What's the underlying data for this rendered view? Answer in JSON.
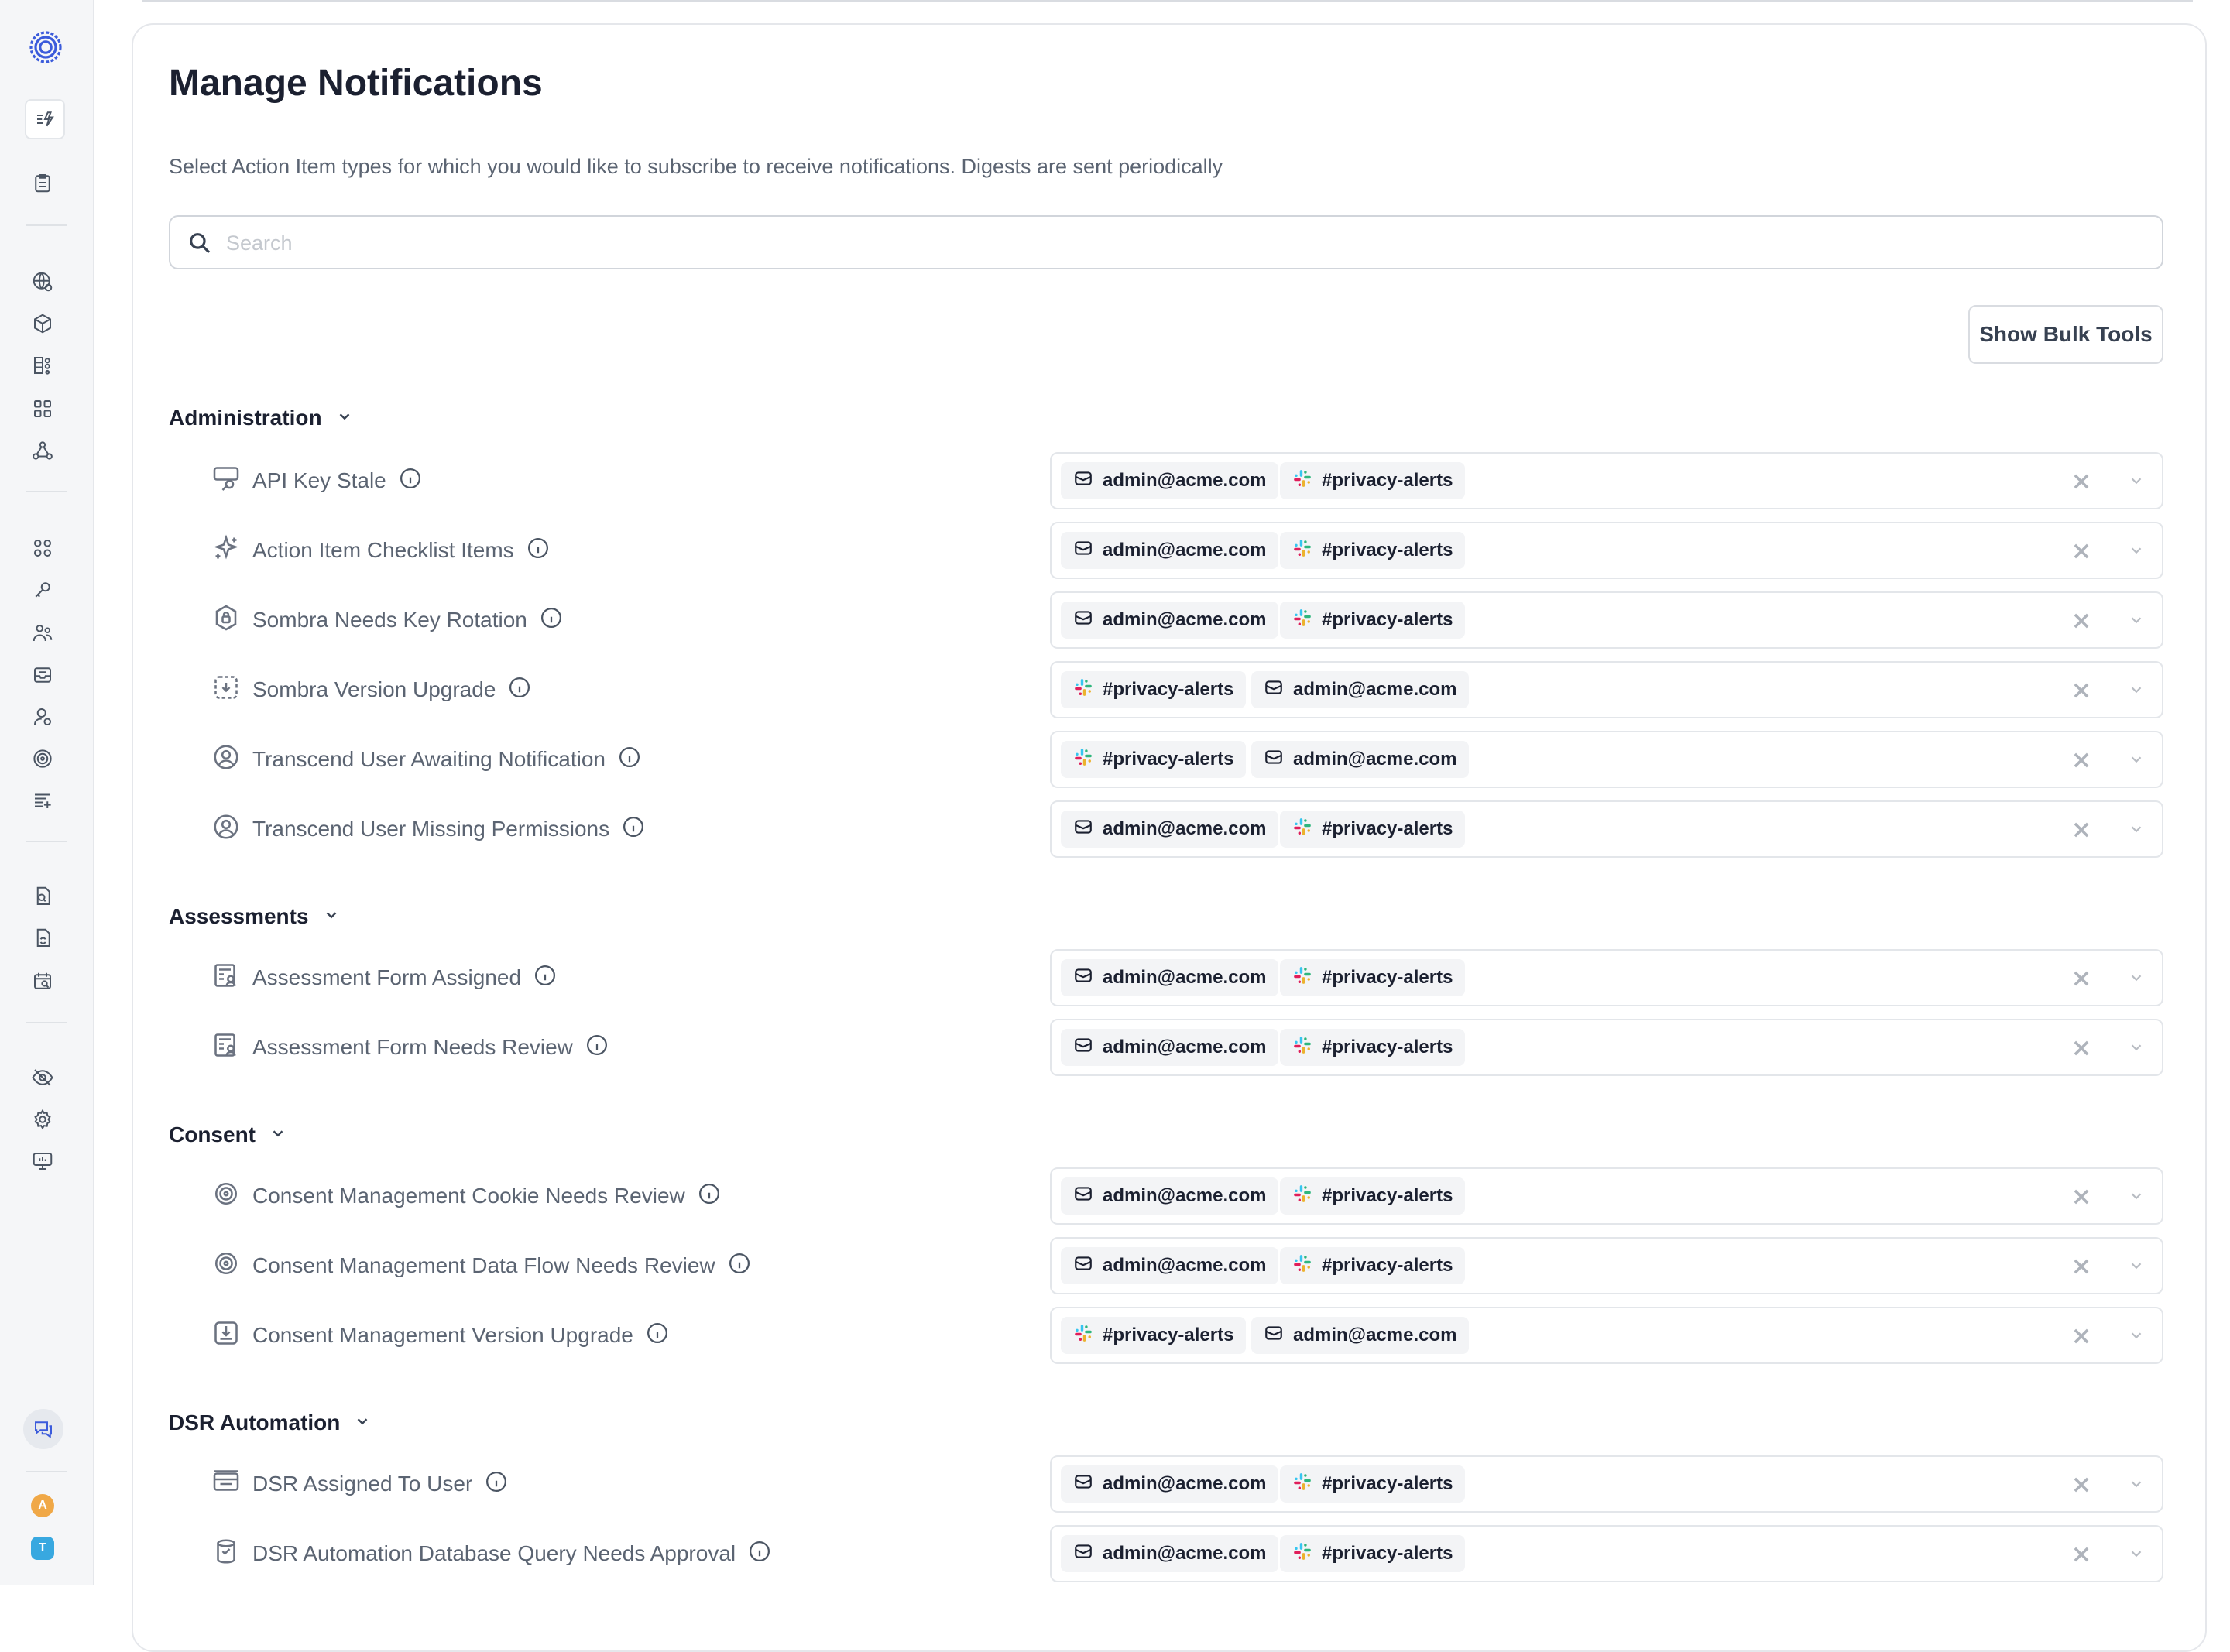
{
  "page": {
    "title": "Manage Notifications",
    "subtitle": "Select Action Item types for which you would like to subscribe to receive notifications. Digests are sent periodically"
  },
  "search": {
    "placeholder": "Search",
    "value": ""
  },
  "bulk_button": "Show Bulk Tools",
  "avatars": [
    {
      "letter": "A",
      "color": "#f0a847"
    },
    {
      "letter": "T",
      "color": "#38a8e0"
    }
  ],
  "colors": {
    "accent": "#3b5bdb",
    "slack": [
      "#e01e5a",
      "#36c5f0",
      "#2eb67d",
      "#ecb22e"
    ]
  },
  "groups": [
    {
      "title": "Administration",
      "rows": [
        {
          "label": "API Key Stale",
          "icon": "api-key-icon",
          "chips": [
            {
              "type": "email",
              "text": "admin@acme.com"
            },
            {
              "type": "slack",
              "text": "#privacy-alerts"
            }
          ]
        },
        {
          "label": "Action Item Checklist Items",
          "icon": "sparkle-icon",
          "chips": [
            {
              "type": "email",
              "text": "admin@acme.com"
            },
            {
              "type": "slack",
              "text": "#privacy-alerts"
            }
          ]
        },
        {
          "label": "Sombra Needs Key Rotation",
          "icon": "lock-icon",
          "chips": [
            {
              "type": "email",
              "text": "admin@acme.com"
            },
            {
              "type": "slack",
              "text": "#privacy-alerts"
            }
          ]
        },
        {
          "label": "Sombra Version Upgrade",
          "icon": "download-icon",
          "chips": [
            {
              "type": "slack",
              "text": "#privacy-alerts"
            },
            {
              "type": "email",
              "text": "admin@acme.com"
            }
          ]
        },
        {
          "label": "Transcend User Awaiting Notification",
          "icon": "user-circle-icon",
          "chips": [
            {
              "type": "slack",
              "text": "#privacy-alerts"
            },
            {
              "type": "email",
              "text": "admin@acme.com"
            }
          ]
        },
        {
          "label": "Transcend User Missing Permissions",
          "icon": "user-circle-icon",
          "chips": [
            {
              "type": "email",
              "text": "admin@acme.com"
            },
            {
              "type": "slack",
              "text": "#privacy-alerts"
            }
          ]
        }
      ]
    },
    {
      "title": "Assessments",
      "rows": [
        {
          "label": "Assessment Form Assigned",
          "icon": "form-icon",
          "chips": [
            {
              "type": "email",
              "text": "admin@acme.com"
            },
            {
              "type": "slack",
              "text": "#privacy-alerts"
            }
          ]
        },
        {
          "label": "Assessment Form Needs Review",
          "icon": "form-icon",
          "chips": [
            {
              "type": "email",
              "text": "admin@acme.com"
            },
            {
              "type": "slack",
              "text": "#privacy-alerts"
            }
          ]
        }
      ]
    },
    {
      "title": "Consent",
      "rows": [
        {
          "label": "Consent Management Cookie Needs Review",
          "icon": "target-icon",
          "chips": [
            {
              "type": "email",
              "text": "admin@acme.com"
            },
            {
              "type": "slack",
              "text": "#privacy-alerts"
            }
          ]
        },
        {
          "label": "Consent Management Data Flow Needs Review",
          "icon": "target-icon",
          "chips": [
            {
              "type": "email",
              "text": "admin@acme.com"
            },
            {
              "type": "slack",
              "text": "#privacy-alerts"
            }
          ]
        },
        {
          "label": "Consent Management Version Upgrade",
          "icon": "download-box-icon",
          "chips": [
            {
              "type": "slack",
              "text": "#privacy-alerts"
            },
            {
              "type": "email",
              "text": "admin@acme.com"
            }
          ]
        }
      ]
    },
    {
      "title": "DSR Automation",
      "rows": [
        {
          "label": "DSR Assigned To User",
          "icon": "inbox-stack-icon",
          "chips": [
            {
              "type": "email",
              "text": "admin@acme.com"
            },
            {
              "type": "slack",
              "text": "#privacy-alerts"
            }
          ]
        },
        {
          "label": "DSR Automation Database Query Needs Approval",
          "icon": "database-icon",
          "chips": [
            {
              "type": "email",
              "text": "admin@acme.com"
            },
            {
              "type": "slack",
              "text": "#privacy-alerts"
            }
          ]
        }
      ]
    }
  ],
  "sidebar_icons": [
    "logo-icon",
    "action-items-icon",
    "clipboard-icon",
    "globe-icon",
    "cube-icon",
    "data-inventory-icon",
    "apps-icon",
    "connections-icon",
    "integrations-icon",
    "key-link-icon",
    "people-icon",
    "inbox-icon",
    "user-icon",
    "target-icon",
    "list-icon",
    "document-search-icon",
    "file-sync-icon",
    "calendar-search-icon",
    "eye-off-icon",
    "settings-icon",
    "monitor-icon",
    "chat-icon"
  ]
}
